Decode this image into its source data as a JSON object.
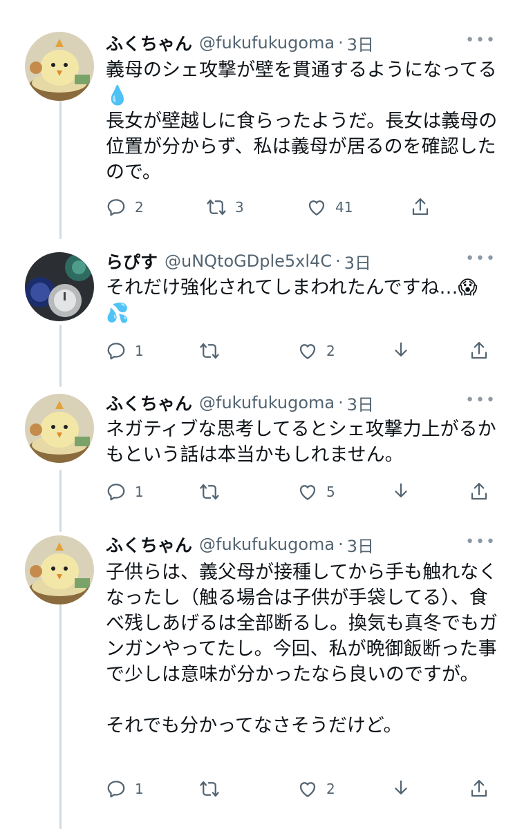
{
  "tweets": [
    {
      "name": "ふくちゃん",
      "handle": "@fukufukugoma",
      "sep": "·",
      "time": "3日",
      "more": "•••",
      "text": "義母のシェ攻撃が壁を貫通するようになってる💧\n長女が壁越しに食らったようだ。長女は義母の位置が分からず、私は義母が居るのを確認したので。",
      "reply_count": "2",
      "retweet_count": "3",
      "like_count": "41",
      "icons": [
        "reply-icon",
        "retweet-icon",
        "like-icon",
        "share-icon"
      ]
    },
    {
      "name": "らぴす",
      "handle": "@uNQtoGDple5xl4C",
      "sep": "·",
      "time": "3日",
      "more": "•••",
      "text": "それだけ強化されてしまわれたんですね…😱\n💦",
      "reply_count": "1",
      "retweet_count": "",
      "like_count": "2",
      "icons": [
        "reply-icon",
        "retweet-icon",
        "like-icon",
        "download-icon",
        "share-icon"
      ]
    },
    {
      "name": "ふくちゃん",
      "handle": "@fukufukugoma",
      "sep": "·",
      "time": "3日",
      "more": "•••",
      "text": "ネガティブな思考してるとシェ攻撃力上がるかもという話は本当かもしれません。",
      "reply_count": "1",
      "retweet_count": "",
      "like_count": "5",
      "icons": [
        "reply-icon",
        "retweet-icon",
        "like-icon",
        "download-icon",
        "share-icon"
      ]
    },
    {
      "name": "ふくちゃん",
      "handle": "@fukufukugoma",
      "sep": "·",
      "time": "3日",
      "more": "•••",
      "text": "子供らは、義父母が接種してから手も触れなくなったし（触る場合は子供が手袋してる）、食べ残しあげるは全部断るし。換気も真冬でもガンガンやってたし。今回、私が晩御飯断った事で少しは意味が分かったなら良いのですが。\n\nそれでも分かってなさそうだけど。",
      "reply_count": "1",
      "retweet_count": "",
      "like_count": "2",
      "icons": [
        "reply-icon",
        "retweet-icon",
        "like-icon",
        "download-icon",
        "share-icon"
      ]
    }
  ],
  "colors": {
    "text": "#0f1419",
    "muted": "#536471",
    "thread_line": "#cfd9de"
  }
}
